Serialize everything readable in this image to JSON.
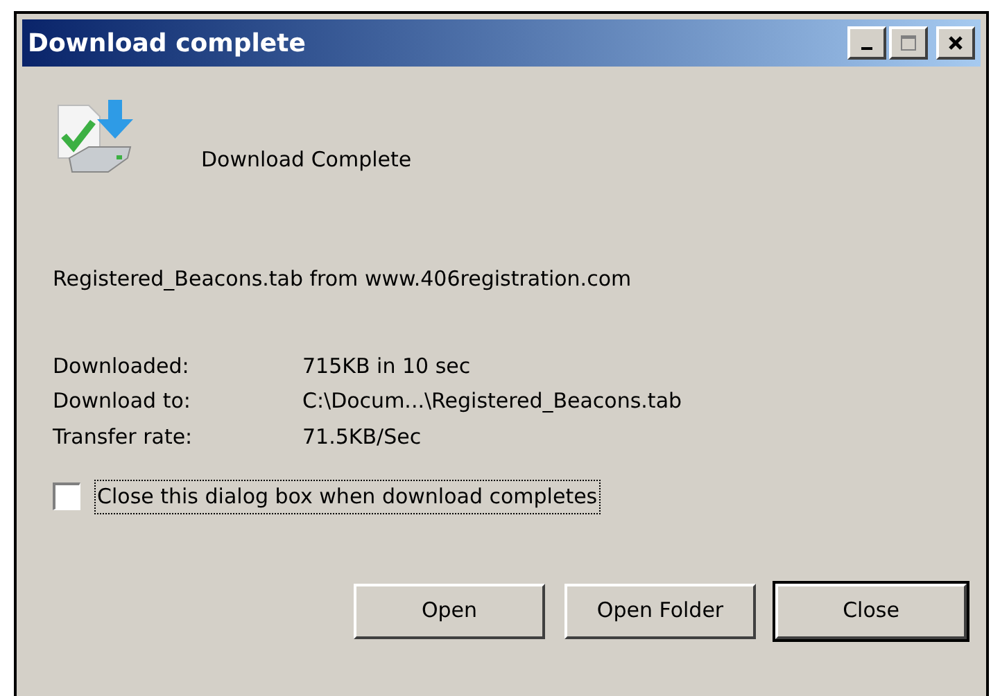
{
  "window": {
    "title": "Download complete",
    "controls": [
      {
        "kind": "minimize"
      },
      {
        "kind": "maximize"
      },
      {
        "kind": "close"
      }
    ]
  },
  "heading": "Download Complete",
  "source": "Registered_Beacons.tab from www.406registration.com",
  "details": [
    {
      "label": "Downloaded:",
      "value": "715KB in 10 sec"
    },
    {
      "label": "Download to:",
      "value": "C:\\Docum...\\Registered_Beacons.tab"
    },
    {
      "label": "Transfer rate:",
      "value": "71.5KB/Sec"
    }
  ],
  "close_when_done": {
    "label": "Close this dialog box when download completes",
    "checked": false
  },
  "buttons": [
    {
      "label": "Open",
      "default": false
    },
    {
      "label": "Open Folder",
      "default": false
    },
    {
      "label": "Close",
      "default": true
    }
  ]
}
